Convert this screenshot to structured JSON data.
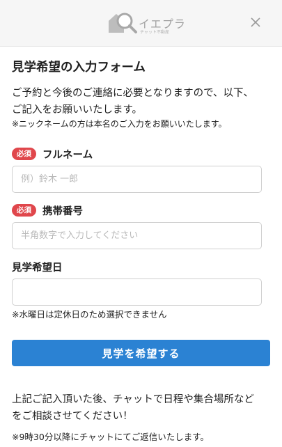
{
  "header": {
    "logo_title": "イエプラ",
    "logo_subtitle": "チャット不動産",
    "close_icon": "close-icon"
  },
  "form": {
    "title": "見学希望の入力フォーム",
    "intro_line1": "ご予約と今後のご連絡に必要となりますので、以下、",
    "intro_line2": "ご記入をお願いいたします。",
    "note": "※ニックネームの方は本名のご入力をお願いいたします。",
    "fields": [
      {
        "required_badge": "必須",
        "label": "フルネーム",
        "value": "",
        "placeholder": "例）鈴木 一郎"
      },
      {
        "required_badge": "必須",
        "label": "携帯番号",
        "value": "",
        "placeholder": "半角数字で入力してください"
      },
      {
        "label": "見学希望日",
        "value": "",
        "placeholder": ""
      }
    ],
    "date_note": "※水曜日は定休日のため選択できません",
    "submit_label": "見学を希望する",
    "after_line1": "上記ご記入頂いた後、チャットで日程や集合場所など",
    "after_line2": "をご相談させてください！",
    "after_note": "※9時30分以降にチャットにてご返信いたします。"
  },
  "colors": {
    "accent": "#2b82d3",
    "required_badge": "#e0474c",
    "header_bg": "#f6f6f6"
  }
}
